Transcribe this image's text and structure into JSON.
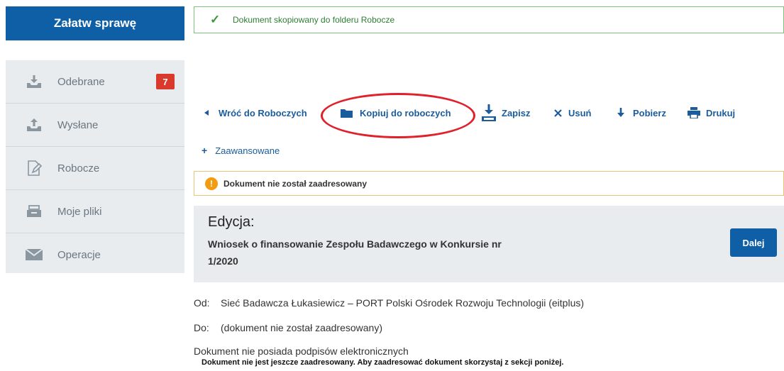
{
  "sidebar": {
    "cta_label": "Załatw sprawę",
    "items": [
      {
        "label": "Odebrane",
        "icon": "inbox-download-icon",
        "badge": "7"
      },
      {
        "label": "Wysłane",
        "icon": "outbox-upload-icon"
      },
      {
        "label": "Robocze",
        "icon": "draft-edit-icon"
      },
      {
        "label": "Moje pliki",
        "icon": "file-drawer-icon"
      },
      {
        "label": "Operacje",
        "icon": "envelope-icon"
      }
    ]
  },
  "notifications": {
    "success": "Dokument skopiowany do folderu Robocze",
    "warning": "Dokument nie został zaadresowany"
  },
  "toolbar": {
    "back": "Wróć do Roboczych",
    "copy": "Kopiuj do roboczych",
    "save": "Zapisz",
    "delete": "Usuń",
    "download": "Pobierz",
    "print": "Drukuj"
  },
  "advanced_label": "Zaawansowane",
  "edit": {
    "heading": "Edycja:",
    "title": "Wniosek o finansowanie Zespołu Badawczego w Konkursie nr 1/2020",
    "next_button": "Dalej"
  },
  "details": {
    "from_label": "Od:",
    "from_value": "Sieć Badawcza Łukasiewicz – PORT Polski Ośrodek Rozwoju Technologii (eitplus)",
    "to_label": "Do:",
    "to_value": "(dokument nie został zaadresowany)",
    "signatures": "Dokument nie posiada podpisów elektronicznych",
    "address_note": "Dokument nie jest jeszcze zaadresowany. Aby zaadresować dokument skorzystaj z sekcji poniżej."
  },
  "colors": {
    "primary": "#0f5fa6",
    "link": "#1a5c9c",
    "badge": "#d93a2b",
    "success": "#3a9a3a",
    "warning": "#f39c12",
    "annotation": "#e0202a"
  }
}
